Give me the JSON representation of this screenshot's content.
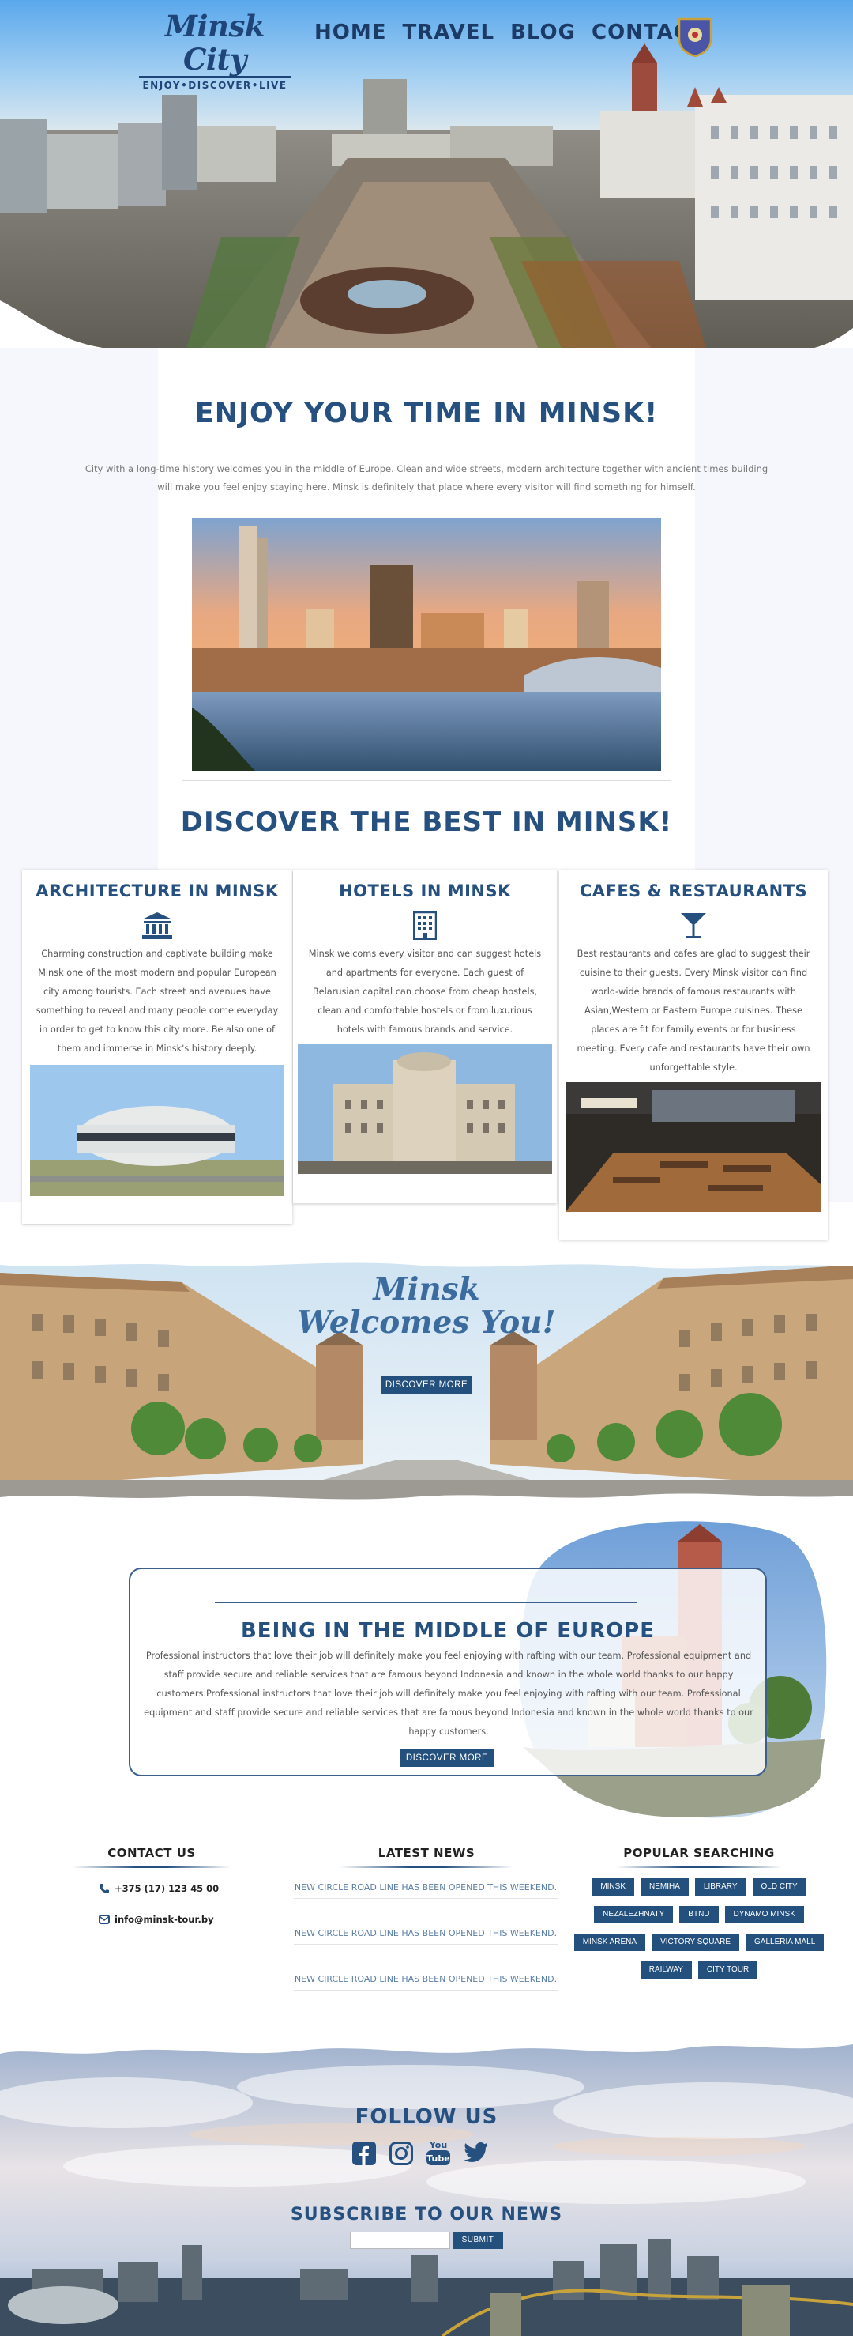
{
  "header": {
    "logo_name": "Minsk City",
    "logo_tagline": "ENJOY•DISCOVER•LIVE",
    "nav": [
      "HOME",
      "TRAVEL",
      "BLOG",
      "CONTACT"
    ]
  },
  "intro": {
    "title": "ENJOY YOUR TIME IN MINSK!",
    "text": "City with a long-time history welcomes you in the middle of Europe. Clean and wide streets, modern architecture together with ancient times building will make you feel enjoy staying here. Minsk is definitely that place where every visitor will find something for himself."
  },
  "discover": {
    "title": "DISCOVER THE BEST IN MINSK!",
    "cards": [
      {
        "title": "ARCHITECTURE IN MINSK",
        "icon": "bank-icon",
        "text": "Charming construction and captivate building make Minsk one of the most modern and popular European city among tourists. Each street and avenues have something to reveal and many people come everyday in order to get to know this city more. Be also one of them and immerse in Minsk's history deeply."
      },
      {
        "title": "HOTELS IN MINSK",
        "icon": "building-icon",
        "text": "Minsk welcoms every visitor and can suggest hotels and apartments for everyone. Each guest of Belarusian capital can choose from cheap hostels, clean and comfortable hostels or from luxurious hotels with famous brands and service."
      },
      {
        "title": "CAFES & RESTAURANTS",
        "icon": "cocktail-icon",
        "text": "Best restaurants and cafes are glad to suggest their cuisine to their guests. Every Minsk visitor can find world-wide brands of famous restaurants with Asian,Western or Eastern Europe cuisines. These places are fit for family events or for business meeting. Every cafe and restaurants have their own unforgettable style."
      }
    ]
  },
  "welcome": {
    "line1": "Minsk",
    "line2": "Welcomes You!",
    "button": "DISCOVER MORE"
  },
  "europe": {
    "title": "BEING IN THE MIDDLE OF EUROPE",
    "text": "Professional instructors that love their job will definitely make you feel enjoying with rafting with our team. Professional equipment and staff provide secure and reliable services that are famous beyond Indonesia and known in the whole world thanks to our happy customers.Professional instructors that love their job will definitely make you feel enjoying with rafting with our team. Professional equipment and staff provide secure and reliable services that are famous beyond Indonesia and known in the whole world thanks to our happy customers.",
    "button": "DISCOVER MORE"
  },
  "contact": {
    "title": "CONTACT US",
    "phone": "+375 (17) 123 45 00",
    "email": "info@minsk-tour.by"
  },
  "news": {
    "title": "LATEST NEWS",
    "items": [
      "NEW CIRCLE ROAD LINE HAS BEEN OPENED THIS WEEKEND.",
      "NEW CIRCLE ROAD LINE HAS BEEN OPENED THIS WEEKEND.",
      "NEW CIRCLE ROAD LINE HAS BEEN OPENED THIS WEEKEND."
    ]
  },
  "popular": {
    "title": "POPULAR SEARCHING",
    "rows": [
      [
        "MINSK",
        "NEMIHA",
        "LIBRARY",
        "OLD CITY"
      ],
      [
        "NEZALEZHNATY",
        "BTNU",
        "DYNAMO MINSK"
      ],
      [
        "MINSK ARENA",
        "VICTORY SQUARE",
        "GALLERIA MALL"
      ],
      [
        "RAILWAY",
        "CITY TOUR"
      ]
    ]
  },
  "follow": {
    "title": "FOLLOW US",
    "youtube_label_1": "You",
    "youtube_label_2": "Tube",
    "icons": [
      "facebook-icon",
      "instagram-icon",
      "youtube-icon",
      "twitter-icon"
    ]
  },
  "subscribe": {
    "title": "SUBSCRIBE TO OUR NEWS",
    "input_placeholder": "",
    "button": "SUBMIT"
  },
  "colors": {
    "primary": "#26507f",
    "button": "#23507d",
    "link": "#5b7fa5"
  }
}
